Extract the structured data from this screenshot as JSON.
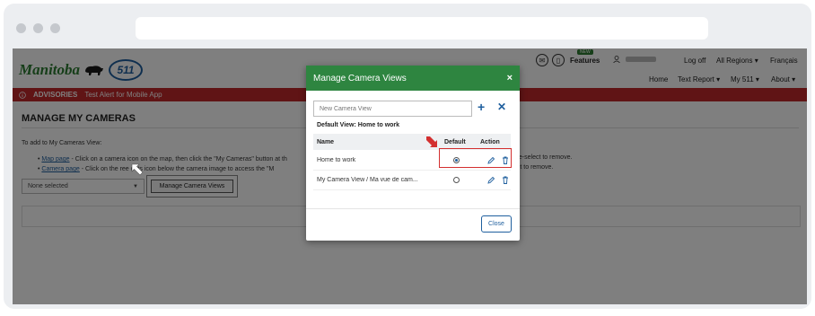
{
  "site": {
    "logo_text": "Manitoba",
    "badge": "511",
    "features_label": "Features",
    "new_badge": "NEW",
    "top_nav": [
      "Log off",
      "All Regions ▾",
      "Français"
    ],
    "main_nav": [
      "Home",
      "Text Report ▾",
      "My 511 ▾",
      "About ▾"
    ]
  },
  "advisory": {
    "label": "ADVISORIES",
    "text": "Test Alert for Mobile App"
  },
  "page": {
    "title": "MANAGE MY CAMERAS",
    "intro": "To add to My Cameras View:",
    "bullet1_link": "Map page",
    "bullet1_text": " - Click on a camera icon on the map, then click the \"My Cameras\" button at th",
    "bullet1_end": "de-select to remove.",
    "bullet2_link": "Camera page",
    "bullet2_text": " - Click on the  ree dots icon below the camera image to access the \"M",
    "bullet2_end": "ect to remove.",
    "select_value": "None selected",
    "manage_button": "Manage Camera Views"
  },
  "modal": {
    "title": "Manage Camera Views",
    "close_x": "×",
    "new_placeholder": "New Camera View",
    "add_symbol": "+",
    "cancel_symbol": "✕",
    "default_view": "Default View: Home to work",
    "columns": {
      "name": "Name",
      "default": "Default",
      "action": "Action"
    },
    "rows": [
      {
        "name": "Home to work",
        "default": true
      },
      {
        "name": "My Camera View / Ma vue de cam...",
        "default": false
      }
    ],
    "close_button": "Close"
  },
  "colors": {
    "brand_green": "#2e8540",
    "advisory_red": "#c0282a",
    "link_blue": "#1f5f9e",
    "highlight_red": "#d32f2f"
  }
}
